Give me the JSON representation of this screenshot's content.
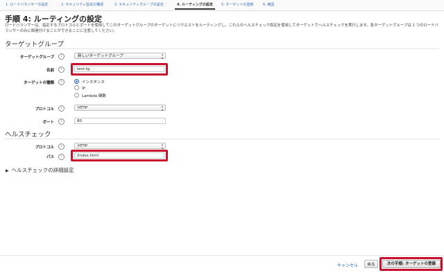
{
  "steps": [
    "1. ロードバランサーの設定",
    "2. セキュリティ設定の構成",
    "3. セキュリティグループの設定",
    "4. ルーティングの設定",
    "5. ターゲットの登録",
    "6. 確認"
  ],
  "page": {
    "title": "手順 4: ルーティングの設定",
    "description": "ロードバランサーは、指定するプロトコルとポートを使用してこのターゲットグループのターゲットにリクエストをルーティングし、これらのヘルスチェック設定を使用してターゲットでヘルスチェックを実行します。各ターゲットグループは 1 つのロードバランサーのみに関連付けることができることに注意してください。"
  },
  "target_group": {
    "section_title": "ターゲットグループ",
    "target_group_label": "ターゲットグループ",
    "target_group_value": "新しいターゲットグループ",
    "name_label": "名前",
    "name_value": "test-tg",
    "type_label": "ターゲットの種類",
    "type_options": [
      "インスタンス",
      "IP",
      "Lambda 関数"
    ],
    "type_selected": "インスタンス",
    "protocol_label": "プロトコル",
    "protocol_value": "HTTP",
    "port_label": "ポート",
    "port_value": "80"
  },
  "health_check": {
    "section_title": "ヘルスチェック",
    "protocol_label": "プロトコル",
    "protocol_value": "HTTP",
    "path_label": "パス",
    "path_value": "/index.html",
    "advanced_label": "ヘルスチェックの詳細設定"
  },
  "footer": {
    "cancel_label": "キャンセル",
    "back_label": "戻る",
    "next_label": "次の手順: ターゲットの登録"
  },
  "icons": {
    "info": "i",
    "expand": "▶",
    "select_arrows": "▴▾"
  },
  "colors": {
    "highlight": "#c8102e",
    "link": "#2a6ebb"
  }
}
